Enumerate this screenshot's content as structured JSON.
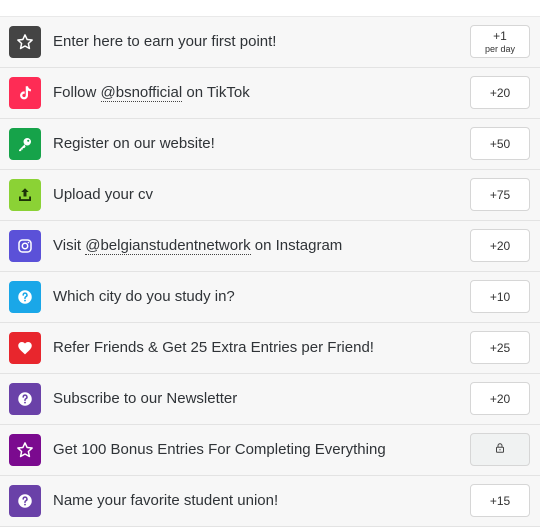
{
  "entries": [
    {
      "label": "Enter here to earn your first point!",
      "points": "+1",
      "sub": "per day",
      "icon": "star-icon",
      "color": "#444444"
    },
    {
      "pre": "Follow ",
      "handle": "@bsnofficial",
      "post": " on TikTok",
      "points": "+20",
      "icon": "tiktok-icon",
      "color": "#fe2c55"
    },
    {
      "label": "Register on our website!",
      "points": "+50",
      "icon": "key-icon",
      "color": "#16a34a"
    },
    {
      "label": "Upload your cv",
      "points": "+75",
      "icon": "upload-icon",
      "color": "#8bd235"
    },
    {
      "pre": "Visit ",
      "handle": "@belgianstudentnetwork",
      "post": " on Instagram",
      "points": "+20",
      "icon": "instagram-icon",
      "color": "#5b51d8"
    },
    {
      "label": "Which city do you study in?",
      "points": "+10",
      "icon": "question-icon",
      "color": "#1aa7e8"
    },
    {
      "label": "Refer Friends & Get 25 Extra Entries per Friend!",
      "points": "+25",
      "icon": "heart-icon",
      "color": "#e8262d"
    },
    {
      "label": "Subscribe to our Newsletter",
      "points": "+20",
      "icon": "question-icon",
      "color": "#6a41a8"
    },
    {
      "label": "Get 100 Bonus Entries For Completing Everything",
      "points": "",
      "locked": true,
      "icon": "star-icon",
      "color": "#7b0a8f"
    },
    {
      "label": "Name your favorite student union!",
      "points": "+15",
      "icon": "question-icon",
      "color": "#6a41a8"
    }
  ]
}
